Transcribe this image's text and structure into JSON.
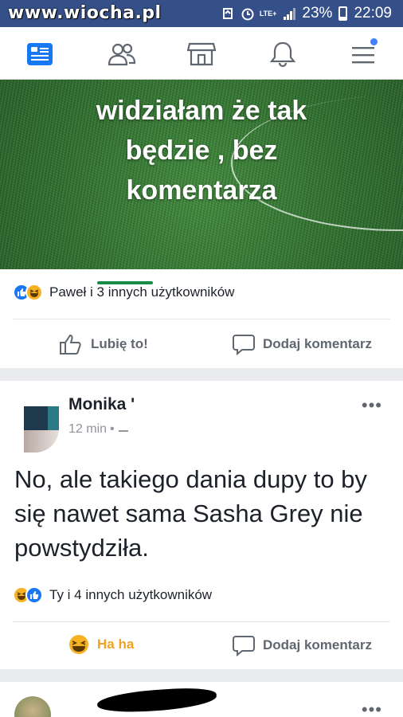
{
  "status_bar": {
    "watermark": "www.wiocha.pl",
    "network": "LTE+",
    "battery": "23%",
    "time": "22:09"
  },
  "nav": {
    "items": [
      "feed-icon",
      "friends-icon",
      "marketplace-icon",
      "notifications-icon",
      "menu-icon"
    ],
    "accent": "#4080ff"
  },
  "post1": {
    "image_text": [
      "widziałam że tak",
      "będzie , bez",
      "komentarza"
    ],
    "reactions_text": "Paweł      i 3 innych użytkowników",
    "like_label": "Lubię to!",
    "comment_label": "Dodaj komentarz"
  },
  "comment_card": {
    "author": "Monika '",
    "time": "12 min",
    "text": "No, ale takiego dania dupy to by się nawet sama Sasha Grey nie powstydziła.",
    "reactions_text": "Ty i 4 innych użytkowników",
    "haha_label": "Ha ha",
    "comment_label": "Dodaj komentarz"
  },
  "colors": {
    "header": "#355089",
    "like_blue": "#1877f2",
    "haha_yellow": "#f7b125",
    "haha_text": "#f0a220"
  }
}
